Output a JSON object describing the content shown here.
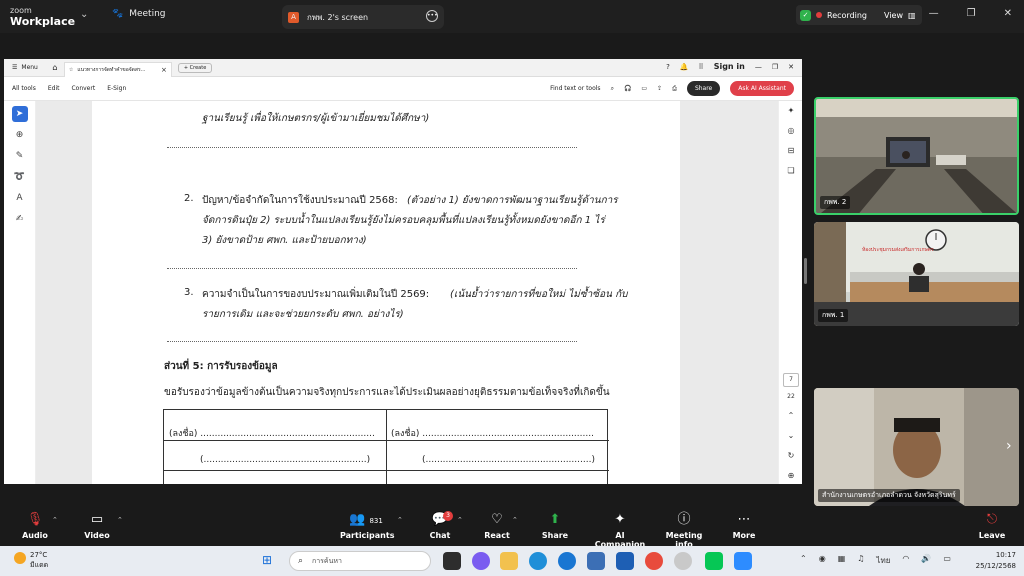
{
  "topbar": {
    "logo_line1": "zoom",
    "logo_line2": "Workplace",
    "meeting_label": "Meeting",
    "share_tab_label": "กพพ. 2's screen",
    "recording_label": "Recording",
    "view_label": "View"
  },
  "viewer": {
    "menu_label": "Menu",
    "doc_tab_title": "แนวทางการจัดทำคำขอจัดสร...",
    "create_label": "Create",
    "sign_in_label": "Sign in",
    "tools": [
      "All tools",
      "Edit",
      "Convert",
      "E-Sign"
    ],
    "find_label": "Find text or tools",
    "share_btn": "Share",
    "ai_btn": "Ask AI Assistant",
    "page_current": "7",
    "page_total": "22"
  },
  "document": {
    "line_top": "ฐานเรียนรู้ เพื่อให้เกษตรกร/ผู้เข้ามาเยี่ยมชมได้ศึกษา)",
    "item2_num": "2.",
    "item2_l1a": "ปัญหา/ข้อจำกัดในการใช้งบประมาณปี 2568:",
    "item2_l1b": "(ตัวอย่าง 1) ยังขาดการพัฒนาฐานเรียนรู้ด้านการ",
    "item2_l2": "จัดการดินปุ๋ย 2) ระบบน้ำในแปลงเรียนรู้ยังไม่ครอบคลุมพื้นที่แปลงเรียนรู้ทั้งหมดยังขาดอีก 1 ไร่",
    "item2_l3": "3) ยังขาดป้าย ศพก. และป้ายบอกทาง)",
    "item3_num": "3.",
    "item3_l1a": "ความจำเป็นในการของบประมาณเพิ่มเติมในปี 2569:",
    "item3_l1b": "(เน้นย้ำว่ารายการที่ขอใหม่ ไม่ซ้ำซ้อน กับ",
    "item3_l2": "รายการเดิม และจะช่วยยกระดับ ศพก. อย่างไร)",
    "section_title": "ส่วนที่ 5: การรับรองข้อมูล",
    "certify_text": "ขอรับรองว่าข้อมูลข้างต้นเป็นความจริงทุกประการและได้ประเมินผลอย่างยุติธรรมตามข้อเท็จจริงที่เกิดขึ้น",
    "sign_left": "(ลงชื่อ) .............................................................",
    "sign_right": "(ลงชื่อ) ............................................................",
    "paren_left": "(.........................................................)",
    "paren_right": "(..........................................................)"
  },
  "participants": {
    "video1_label": "กพพ. 2",
    "video2_label": "กพพ. 1",
    "video2_wall_text": "ห้องประชุมกรมส่งเสริมการเกษตร",
    "video3_label": "สำนักงานเกษตรอำเภอลำดวน จังหวัดสุรินทร์"
  },
  "toolbar": {
    "audio": "Audio",
    "video": "Video",
    "participants": "Participants",
    "participants_count": "831",
    "chat": "Chat",
    "chat_badge": "3",
    "react": "React",
    "share": "Share",
    "ai_companion": "AI Companion",
    "meeting_info": "Meeting info",
    "more": "More",
    "leave": "Leave"
  },
  "taskbar": {
    "temp": "27°C",
    "weather": "มีแดด",
    "search_placeholder": "การค้นหา",
    "lang": "ไทย",
    "time": "10:17",
    "date": "25/12/2568"
  },
  "colors": {
    "active_speaker": "#3ad06a",
    "ai_button": "#e0404a",
    "record": "#e23d3d",
    "share_green": "#2fb24c"
  }
}
